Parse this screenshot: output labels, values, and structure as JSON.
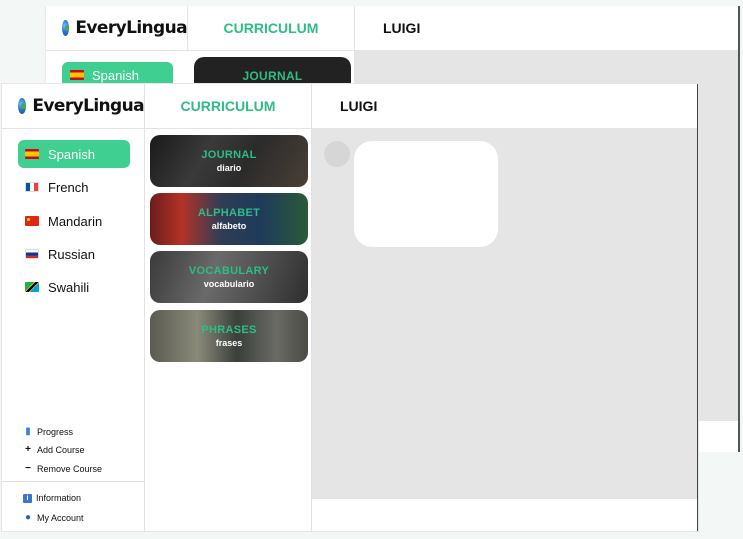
{
  "app": {
    "brand": "EveryLingua",
    "curriculum_tab": "CURRICULUM",
    "user_name": "LUIGI",
    "accent_color": "#3fcf91",
    "curriculum_color": "#2ebd85"
  },
  "back_window": {
    "active_language": "Spanish",
    "card_title": "JOURNAL"
  },
  "sidebar": {
    "languages": [
      {
        "label": "Spanish",
        "flag": "spain-flag-icon",
        "active": true
      },
      {
        "label": "French",
        "flag": "france-flag-icon",
        "active": false
      },
      {
        "label": "Mandarin",
        "flag": "china-flag-icon",
        "active": false
      },
      {
        "label": "Russian",
        "flag": "russia-flag-icon",
        "active": false
      },
      {
        "label": "Swahili",
        "flag": "tanzania-flag-icon",
        "active": false
      }
    ],
    "actions": {
      "progress": "Progress",
      "add_course": "Add Course",
      "remove_course": "Remove Course",
      "information": "Information",
      "my_account": "My Account"
    }
  },
  "curriculum": {
    "cards": [
      {
        "title": "JOURNAL",
        "subtitle": "diario"
      },
      {
        "title": "ALPHABET",
        "subtitle": "alfabeto"
      },
      {
        "title": "VOCABULARY",
        "subtitle": "vocabulario"
      },
      {
        "title": "PHRASES",
        "subtitle": "frases"
      }
    ]
  }
}
